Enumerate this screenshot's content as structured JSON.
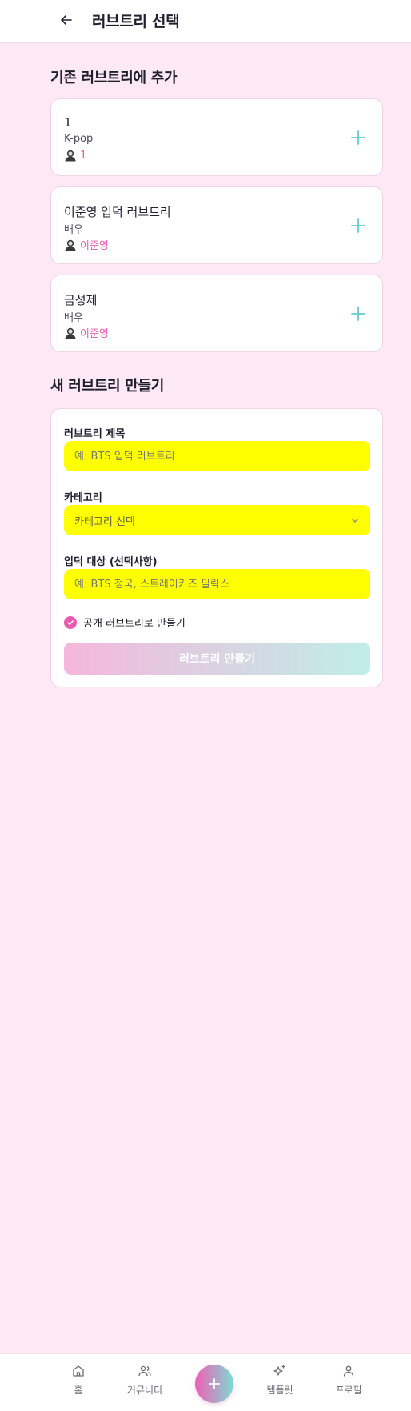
{
  "header": {
    "title": "러브트리 선택"
  },
  "existing": {
    "section_title": "기존 러브트리에 추가",
    "items": [
      {
        "title": "1",
        "category": "K-pop",
        "target": "1"
      },
      {
        "title": "이준영 입덕 러브트리",
        "category": "배우",
        "target": "이준영"
      },
      {
        "title": "금성제",
        "category": "배우",
        "target": "이준영"
      }
    ]
  },
  "create": {
    "section_title": "새 러브트리 만들기",
    "title_label": "러브트리 제목",
    "title_placeholder": "예: BTS 입덕 러브트리",
    "category_label": "카테고리",
    "category_value": "카테고리 선택",
    "target_label": "입덕 대상 (선택사항)",
    "target_placeholder": "예: BTS 정국, 스트레이키즈 필릭스",
    "public_label": "공개 러브트리로 만들기",
    "public_checked": true,
    "submit_label": "러브트리 만들기"
  },
  "nav": {
    "home": "홈",
    "community": "커뮤니티",
    "templates": "템플릿",
    "profile": "프로필"
  },
  "colors": {
    "accent_pink": "#e65bb0",
    "accent_teal": "#5fd0c8",
    "field_bg": "#ffff00",
    "page_bg": "#fde8f6"
  },
  "icons": {
    "back": "arrow-left-icon",
    "add": "plus-icon",
    "target": "avatar-icon",
    "chevron": "chevron-down-icon",
    "check": "check-icon",
    "home": "home-icon",
    "community": "users-icon",
    "fab": "plus-icon",
    "templates": "sparkles-icon",
    "profile": "user-icon"
  }
}
